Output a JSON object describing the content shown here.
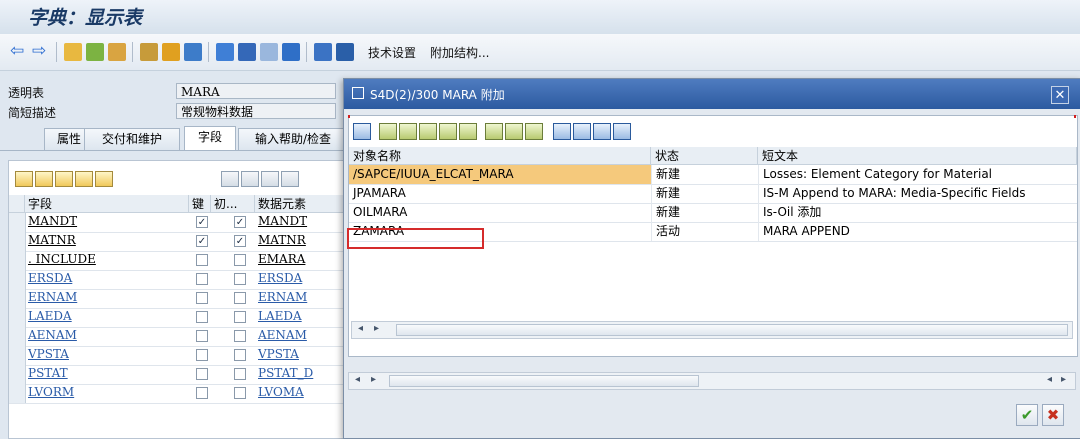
{
  "window": {
    "title": "字典：显示表"
  },
  "toolbar": {
    "text_buttons": [
      "技术设置",
      "附加结构..."
    ],
    "icons": [
      "back-arrow-icon",
      "forward-arrow-icon",
      "glasses-icon",
      "object-icon",
      "copy-icon",
      "hierarchy-icon",
      "activate-icon",
      "where-used-icon",
      "table-icon",
      "align-icon",
      "grid-icon",
      "info-icon",
      "columns-icon",
      "grid2-icon"
    ]
  },
  "header": {
    "table_label": "透明表",
    "table_value": "MARA",
    "desc_label": "简短描述",
    "desc_value": "常规物料数据"
  },
  "tabs": [
    "属性",
    "交付和维护",
    "字段",
    "输入帮助/检查"
  ],
  "field_table": {
    "columns": [
      "字段",
      "键",
      "初...",
      "数据元素"
    ],
    "rows": [
      {
        "field": "MANDT",
        "key": true,
        "init": true,
        "element": "MANDT",
        "link": false
      },
      {
        "field": "MATNR",
        "key": true,
        "init": true,
        "element": "MATNR",
        "link": false
      },
      {
        "field": ". INCLUDE",
        "key": false,
        "init": false,
        "element": "EMARA",
        "link": false
      },
      {
        "field": "ERSDA",
        "key": false,
        "init": false,
        "element": "ERSDA",
        "link": true
      },
      {
        "field": "ERNAM",
        "key": false,
        "init": false,
        "element": "ERNAM",
        "link": true
      },
      {
        "field": "LAEDA",
        "key": false,
        "init": false,
        "element": "LAEDA",
        "link": true
      },
      {
        "field": "AENAM",
        "key": false,
        "init": false,
        "element": "AENAM",
        "link": true
      },
      {
        "field": "VPSTA",
        "key": false,
        "init": false,
        "element": "VPSTA",
        "link": true
      },
      {
        "field": "PSTAT",
        "key": false,
        "init": false,
        "element": "PSTAT_D",
        "link": true
      },
      {
        "field": "LVORM",
        "key": false,
        "init": false,
        "element": "LVOMA",
        "link": true
      }
    ]
  },
  "dialog": {
    "title": "S4D(2)/300 MARA 附加",
    "columns": [
      "对象名称",
      "状态",
      "短文本"
    ],
    "rows": [
      {
        "name": "/SAPCE/IUUA_ELCAT_MARA",
        "status": "新建",
        "text": "Losses: Element Category for Material"
      },
      {
        "name": "JPAMARA",
        "status": "新建",
        "text": "IS-M Append to MARA: Media-Specific Fields"
      },
      {
        "name": "OILMARA",
        "status": "新建",
        "text": "Is-Oil 添加"
      },
      {
        "name": "ZAMARA",
        "status": "活动",
        "text": "MARA APPEND"
      }
    ],
    "ok_glyph": "✔",
    "cancel_glyph": "✖"
  },
  "colors": {
    "highlight_row": "#f5c97c",
    "selection_border": "#d52b2b",
    "dialog_header": "#2c5aa0",
    "link": "#2a5ba8"
  }
}
